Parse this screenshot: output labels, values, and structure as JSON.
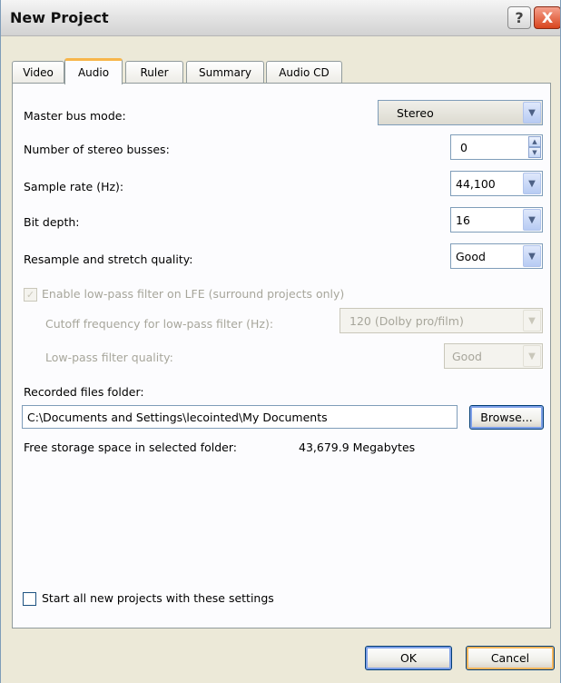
{
  "window": {
    "title": "New Project",
    "help_label": "?",
    "close_label": "X"
  },
  "tabs": [
    {
      "label": "Video"
    },
    {
      "label": "Audio"
    },
    {
      "label": "Ruler"
    },
    {
      "label": "Summary"
    },
    {
      "label": "Audio CD"
    }
  ],
  "audio": {
    "master_bus_label": "Master bus mode:",
    "master_bus_value": "Stereo",
    "stereo_busses_label": "Number of stereo busses:",
    "stereo_busses_value": "0",
    "sample_rate_label": "Sample rate (Hz):",
    "sample_rate_value": "44,100",
    "bit_depth_label": "Bit depth:",
    "bit_depth_value": "16",
    "resample_label": "Resample and stretch quality:",
    "resample_value": "Good",
    "lowpass_enable_label": "Enable low-pass filter on LFE (surround projects only)",
    "cutoff_label": "Cutoff frequency for low-pass filter (Hz):",
    "cutoff_value": "120 (Dolby pro/film)",
    "lp_quality_label": "Low-pass filter quality:",
    "lp_quality_value": "Good",
    "folder_label": "Recorded files folder:",
    "folder_value": "C:\\Documents and Settings\\lecointed\\My Documents",
    "browse_label": "Browse...",
    "free_space_label": "Free storage space in selected folder:",
    "free_space_value": "43,679.9 Megabytes",
    "start_all_label": "Start all new projects with these settings"
  },
  "footer": {
    "ok_label": "OK",
    "cancel_label": "Cancel"
  },
  "icons": {
    "dropdown": "chevron-down-icon",
    "checkmark": "check-icon",
    "spin": "spin-arrows-icon"
  },
  "colors": {
    "tab_accent": "#f7b64b",
    "field_border": "#7f9db9",
    "disabled_text": "#a7a69b"
  }
}
